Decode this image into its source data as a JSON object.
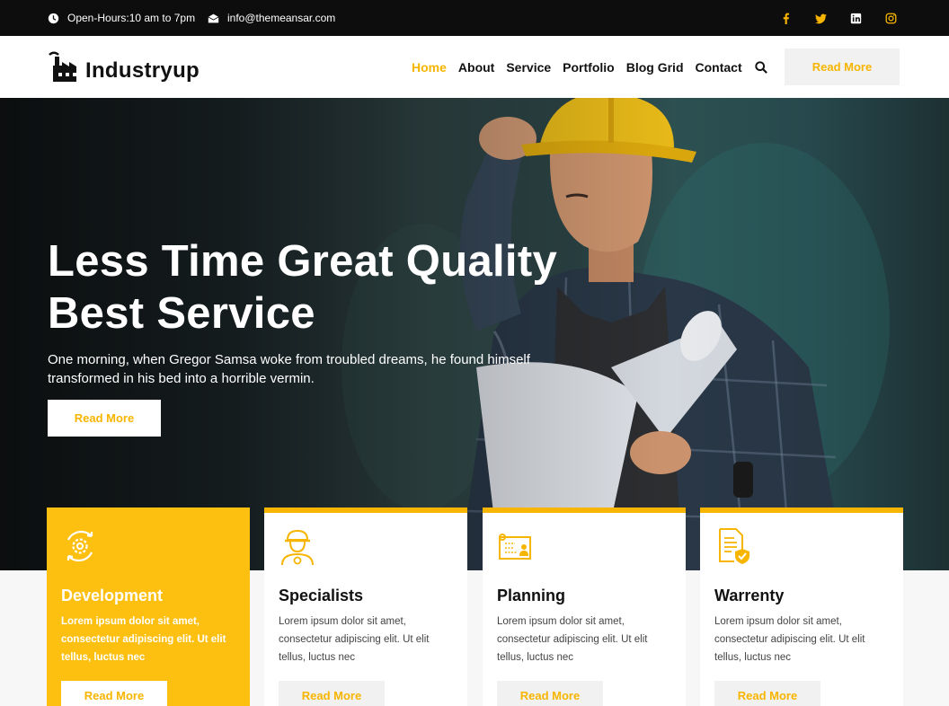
{
  "topbar": {
    "hours": "Open-Hours:10 am to 7pm",
    "email": "info@themeansar.com",
    "socials": [
      "facebook-icon",
      "twitter-icon",
      "linkedin-icon",
      "instagram-icon"
    ]
  },
  "header": {
    "logo": "Industryup",
    "nav": [
      "Home",
      "About",
      "Service",
      "Portfolio",
      "Blog Grid",
      "Contact"
    ],
    "active": "Home",
    "button": "Read More"
  },
  "hero": {
    "title_line1": "Less Time Great Quality",
    "title_line2": "Best Service",
    "text": "One morning, when Gregor Samsa woke from troubled dreams, he found himself transformed in his bed into a horrible vermin.",
    "button": "Read More"
  },
  "cards": [
    {
      "title": "Development",
      "text": "Lorem ipsum dolor sit amet, consectetur adipiscing elit. Ut elit tellus, luctus nec",
      "button": "Read More",
      "icon": "gear-cycle-icon"
    },
    {
      "title": "Specialists",
      "text": "Lorem ipsum dolor sit amet, consectetur adipiscing elit. Ut elit tellus, luctus nec",
      "button": "Read More",
      "icon": "worker-icon"
    },
    {
      "title": "Planning",
      "text": "Lorem ipsum dolor sit amet, consectetur adipiscing elit. Ut elit tellus, luctus nec",
      "button": "Read More",
      "icon": "blueprint-icon"
    },
    {
      "title": "Warrenty",
      "text": "Lorem ipsum dolor sit amet, consectetur adipiscing elit. Ut elit tellus, luctus nec",
      "button": "Read More",
      "icon": "document-shield-icon"
    }
  ],
  "colors": {
    "accent": "#f7b500",
    "topbar": "#0d0d0d"
  }
}
